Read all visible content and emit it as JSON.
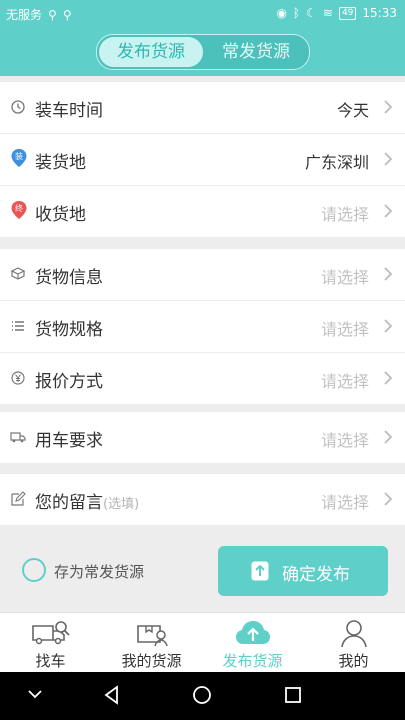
{
  "status_bar": {
    "carrier": "无服务",
    "battery": "49",
    "time": "15:33"
  },
  "segment": {
    "active": "发布货源",
    "inactive": "常发货源"
  },
  "groups": [
    [
      {
        "icon": "clock-icon",
        "label": "装车时间",
        "value": "今天",
        "placeholder": false
      },
      {
        "icon": "loading-location-icon",
        "label": "装货地",
        "value": "广东深圳",
        "placeholder": false
      },
      {
        "icon": "unloading-location-icon",
        "label": "收货地",
        "value": "请选择",
        "placeholder": true
      }
    ],
    [
      {
        "icon": "cargo-box-icon",
        "label": "货物信息",
        "value": "请选择",
        "placeholder": true
      },
      {
        "icon": "list-icon",
        "label": "货物规格",
        "value": "请选择",
        "placeholder": true
      },
      {
        "icon": "yuan-icon",
        "label": "报价方式",
        "value": "请选择",
        "placeholder": true
      }
    ],
    [
      {
        "icon": "truck-icon",
        "label": "用车要求",
        "value": "请选择",
        "placeholder": true
      }
    ],
    [
      {
        "icon": "edit-icon",
        "label": "您的留言",
        "sub": "(选填)",
        "value": "请选择",
        "placeholder": true
      }
    ]
  ],
  "loading_badge": "装",
  "unloading_badge": "终",
  "save_as_frequent": "存为常发货源",
  "confirm_button": "确定发布",
  "tabs": [
    {
      "label": "找车",
      "icon": "find-truck-icon"
    },
    {
      "label": "我的货源",
      "icon": "my-cargo-icon"
    },
    {
      "label": "发布货源",
      "icon": "publish-cargo-icon",
      "active": true
    },
    {
      "label": "我的",
      "icon": "profile-icon"
    }
  ],
  "colors": {
    "accent": "#5ecfc9",
    "loading": "#3d8fe0",
    "unloading": "#e95552"
  }
}
